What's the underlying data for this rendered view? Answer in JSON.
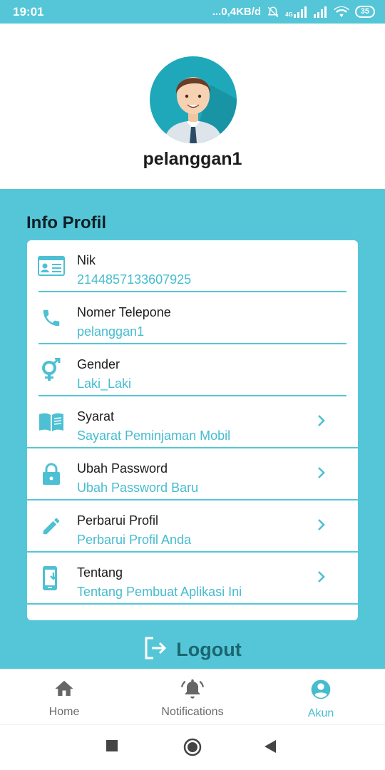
{
  "status_bar": {
    "time": "19:01",
    "speed": "...0,4KB/d",
    "battery": "35",
    "network_label": "4G"
  },
  "profile": {
    "username": "pelanggan1"
  },
  "info": {
    "title": "Info Profil",
    "rows": [
      {
        "label": "Nik",
        "value": "2144857133607925",
        "icon": "id-card-icon",
        "chevron": false
      },
      {
        "label": "Nomer Telepone",
        "value": "pelanggan1",
        "icon": "phone-icon",
        "chevron": false
      },
      {
        "label": "Gender",
        "value": "Laki_Laki",
        "icon": "gender-icon",
        "chevron": false
      },
      {
        "label": "Syarat",
        "value": "Sayarat Peminjaman Mobil",
        "icon": "book-icon",
        "chevron": true
      },
      {
        "label": "Ubah Password",
        "value": "Ubah Password Baru",
        "icon": "lock-icon",
        "chevron": true
      },
      {
        "label": "Perbarui Profil",
        "value": "Perbarui Profil Anda",
        "icon": "pencil-icon",
        "chevron": true
      },
      {
        "label": "Tentang",
        "value": "Tentang Pembuat Aplikasi Ini",
        "icon": "phone-download-icon",
        "chevron": true
      }
    ]
  },
  "logout": {
    "label": "Logout"
  },
  "nav": {
    "items": [
      {
        "label": "Home",
        "icon": "home-icon",
        "active": false
      },
      {
        "label": "Notifications",
        "icon": "bell-icon",
        "active": false
      },
      {
        "label": "Akun",
        "icon": "account-circle-icon",
        "active": true
      }
    ]
  },
  "colors": {
    "accent": "#55c6d8",
    "accent_text": "#46bccf",
    "icon": "#4ec0d3",
    "logout_text": "#1a6670"
  }
}
